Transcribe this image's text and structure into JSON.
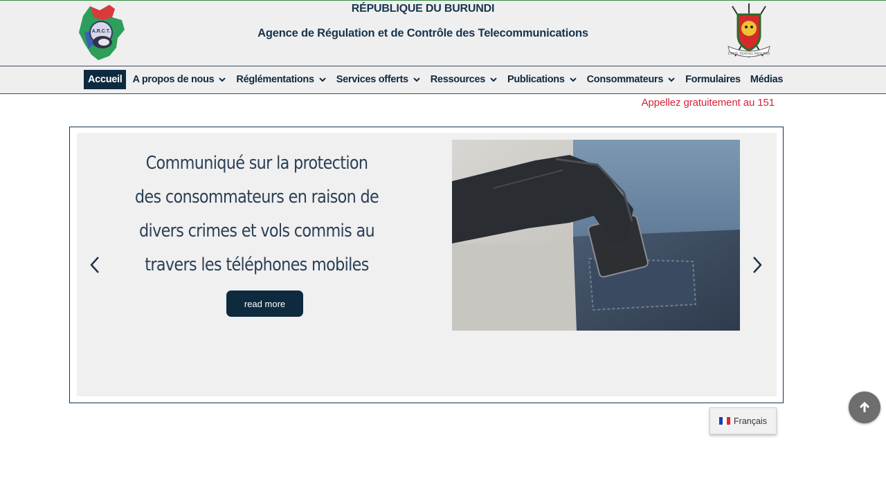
{
  "header": {
    "title": "RÉPUBLIQUE DU BURUNDI",
    "subtitle": "Agence de Régulation et de Contrôle des Telecommunications",
    "logo_left_text": "A.R.C.T.",
    "logo_right_text": "UNITE TRAVAIL PROGRES"
  },
  "nav": {
    "items": [
      {
        "label": "Accueil",
        "dropdown": false,
        "active": true
      },
      {
        "label": "A propos de nous",
        "dropdown": true
      },
      {
        "label": "Réglémentations",
        "dropdown": true
      },
      {
        "label": "Services offerts",
        "dropdown": true
      },
      {
        "label": "Ressources",
        "dropdown": true
      },
      {
        "label": "Publications",
        "dropdown": true
      },
      {
        "label": "Consommateurs",
        "dropdown": true
      },
      {
        "label": "Formulaires",
        "dropdown": false
      },
      {
        "label": "Médias",
        "dropdown": false
      }
    ]
  },
  "call_text": "Appellez gratuitement au 151",
  "slider": {
    "title": "Communiqué sur la protection\ndes consommateurs en raison de\ndivers crimes et vols commis au\ntravers les téléphones mobiles",
    "button_label": "read more",
    "prev_icon": "chevron-left-icon",
    "next_icon": "chevron-right-icon",
    "image_subject": "gloved-hand-stealing-phone-from-jeans-pocket"
  },
  "language": {
    "label": "Français",
    "flag": "france-flag-icon"
  },
  "scroll_top_icon": "arrow-up-icon",
  "colors": {
    "navy": "#0e2a3f",
    "header_bg": "#efefef",
    "call_red": "#d3233a",
    "slide_bg": "#f0f0f0"
  }
}
